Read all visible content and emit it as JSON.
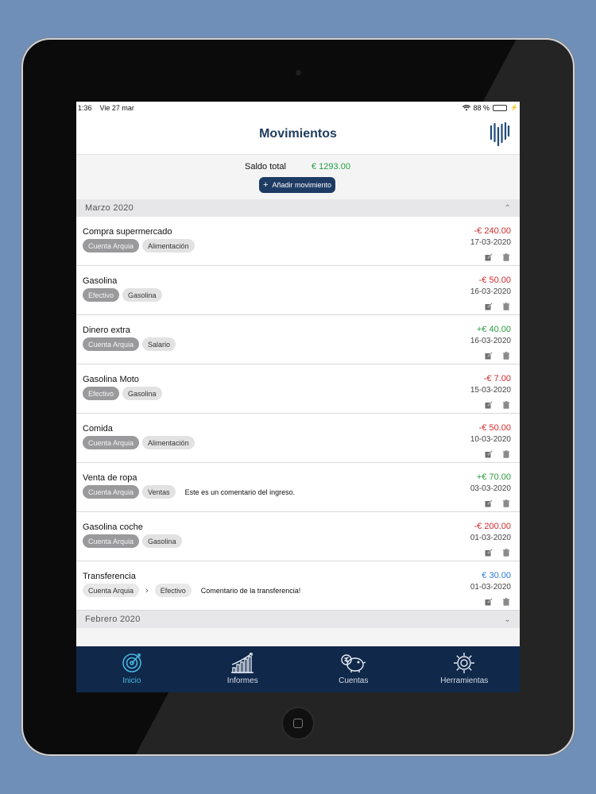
{
  "status": {
    "time": "1:36",
    "date": "Vie 27 mar",
    "battery": "88 %"
  },
  "nav": {
    "title": "Movimientos"
  },
  "summary": {
    "label": "Saldo total",
    "value": "€ 1293.00",
    "add_button": "Añadir movimiento"
  },
  "sections": [
    {
      "label": "Marzo 2020",
      "expanded": true
    },
    {
      "label": "Febrero 2020",
      "expanded": false
    }
  ],
  "movements": [
    {
      "title": "Compra supermercado",
      "tags": [
        "Cuenta Arquia",
        "Alimentación"
      ],
      "comment": "",
      "amount": "-€ 240.00",
      "kind": "neg",
      "date": "17-03-2020"
    },
    {
      "title": "Gasolina",
      "tags": [
        "Efectivo",
        "Gasolina"
      ],
      "comment": "",
      "amount": "-€ 50.00",
      "kind": "neg",
      "date": "16-03-2020"
    },
    {
      "title": "Dinero extra",
      "tags": [
        "Cuenta Arquia",
        "Salario"
      ],
      "comment": "",
      "amount": "+€ 40.00",
      "kind": "pos",
      "date": "16-03-2020"
    },
    {
      "title": "Gasolina Moto",
      "tags": [
        "Efectivo",
        "Gasolina"
      ],
      "comment": "",
      "amount": "-€ 7.00",
      "kind": "neg",
      "date": "15-03-2020"
    },
    {
      "title": "Comida",
      "tags": [
        "Cuenta Arquia",
        "Alimentación"
      ],
      "comment": "",
      "amount": "-€ 50.00",
      "kind": "neg",
      "date": "10-03-2020"
    },
    {
      "title": "Venta de ropa",
      "tags": [
        "Cuenta Arquia",
        "Ventas"
      ],
      "comment": "Este es un comentario del ingreso.",
      "amount": "+€ 70.00",
      "kind": "pos",
      "date": "03-03-2020"
    },
    {
      "title": "Gasolina coche",
      "tags": [
        "Cuenta Arquia",
        "Gasolina"
      ],
      "comment": "",
      "amount": "-€ 200.00",
      "kind": "neg",
      "date": "01-03-2020"
    },
    {
      "title": "Transferencia",
      "tags": [
        "Cuenta Arquia",
        "Efectivo"
      ],
      "comment": "Comentario de la transferencia!",
      "amount": "€ 30.00",
      "kind": "neu",
      "date": "01-03-2020",
      "transfer": true
    }
  ],
  "tabs": [
    {
      "label": "Inicio",
      "icon": "home-target-icon",
      "active": true
    },
    {
      "label": "Informes",
      "icon": "chart-growth-icon",
      "active": false
    },
    {
      "label": "Cuentas",
      "icon": "piggy-bank-icon",
      "active": false
    },
    {
      "label": "Herramientas",
      "icon": "gear-icon",
      "active": false
    }
  ],
  "colors": {
    "brand": "#1e3b63",
    "tabbar": "#10284a",
    "active_tab": "#46b7e3",
    "negative": "#d12a2a",
    "positive": "#2a9a3c",
    "transfer": "#2f7ad8"
  }
}
